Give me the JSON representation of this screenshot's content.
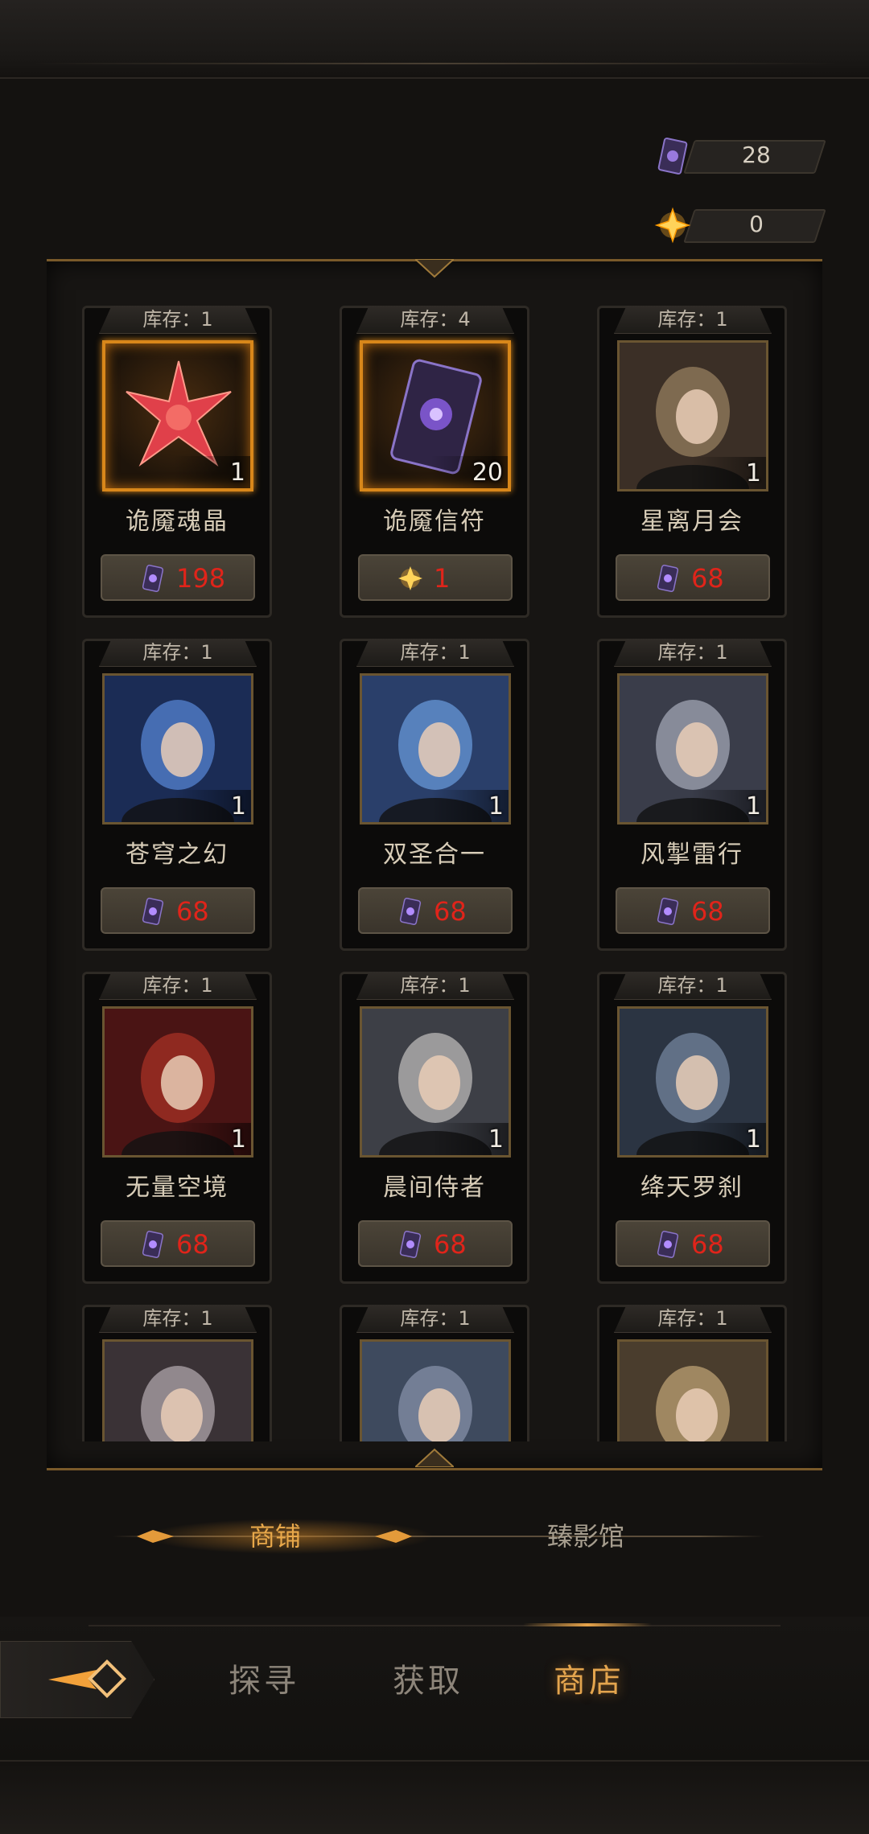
{
  "currency": [
    {
      "name": "demon-card-currency",
      "value": "28"
    },
    {
      "name": "star-currency",
      "value": "0"
    }
  ],
  "stock_label": "库存：",
  "items": [
    {
      "stock": "1",
      "name": "诡魇魂晶",
      "qty": "1",
      "price": "198",
      "price_icon": "card",
      "thumb": "crystal"
    },
    {
      "stock": "4",
      "name": "诡魇信符",
      "qty": "20",
      "price": "1",
      "price_icon": "star",
      "thumb": "card"
    },
    {
      "stock": "1",
      "name": "星离月会",
      "qty": "1",
      "price": "68",
      "price_icon": "card",
      "thumb": "portrait"
    },
    {
      "stock": "1",
      "name": "苍穹之幻",
      "qty": "1",
      "price": "68",
      "price_icon": "card",
      "thumb": "portrait"
    },
    {
      "stock": "1",
      "name": "双圣合一",
      "qty": "1",
      "price": "68",
      "price_icon": "card",
      "thumb": "portrait"
    },
    {
      "stock": "1",
      "name": "风掣雷行",
      "qty": "1",
      "price": "68",
      "price_icon": "card",
      "thumb": "portrait"
    },
    {
      "stock": "1",
      "name": "无量空境",
      "qty": "1",
      "price": "68",
      "price_icon": "card",
      "thumb": "portrait"
    },
    {
      "stock": "1",
      "name": "晨间侍者",
      "qty": "1",
      "price": "68",
      "price_icon": "card",
      "thumb": "portrait"
    },
    {
      "stock": "1",
      "name": "绛天罗刹",
      "qty": "1",
      "price": "68",
      "price_icon": "card",
      "thumb": "portrait"
    },
    {
      "stock": "1",
      "name": "",
      "qty": "",
      "price": "",
      "price_icon": "card",
      "thumb": "portrait"
    },
    {
      "stock": "1",
      "name": "",
      "qty": "",
      "price": "",
      "price_icon": "card",
      "thumb": "portrait"
    },
    {
      "stock": "1",
      "name": "",
      "qty": "",
      "price": "",
      "price_icon": "card",
      "thumb": "portrait"
    }
  ],
  "tabs": {
    "shop": "商铺",
    "gallery": "臻影馆"
  },
  "nav": {
    "explore": "探寻",
    "obtain": "获取",
    "store": "商店"
  },
  "colors": {
    "accent": "#e4a54e",
    "price": "#e0241a",
    "frame": "#6a5531"
  }
}
